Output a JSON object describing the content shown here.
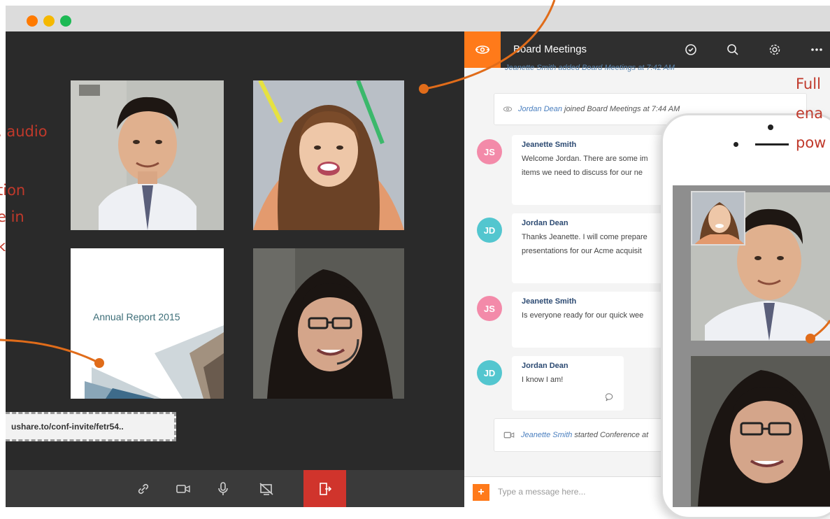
{
  "window": {
    "controls": [
      "close",
      "minimize",
      "maximize"
    ]
  },
  "annotations": {
    "left": [
      ", audio",
      "tion",
      "e in",
      "k"
    ],
    "right": [
      "Full",
      "ena",
      "pow"
    ]
  },
  "video": {
    "document_tile_title": "Annual Report 2015",
    "invite_link": "ushare.to/conf-invite/fetr54.."
  },
  "controls": {
    "icons": [
      "link-icon",
      "camera-icon",
      "microphone-icon",
      "screen-share-icon",
      "leave-icon"
    ]
  },
  "chat": {
    "title": "Board Meetings",
    "top_cut_line": "Jeanette Smith added Board Meetings at 7:42 AM",
    "join_message": {
      "user": "Jordan Dean",
      "text": "joined Board Meetings at 7:44 AM"
    },
    "messages": [
      {
        "initials": "JS",
        "name": "Jeanette Smith",
        "lines": [
          "Welcome Jordan. There are some im",
          "items we need to discuss for our ne"
        ]
      },
      {
        "initials": "JD",
        "name": "Jordan Dean",
        "lines": [
          "Thanks Jeanette. I will come prepare",
          "presentations for our Acme acquisit"
        ]
      },
      {
        "initials": "JS",
        "name": "Jeanette Smith",
        "lines": [
          "Is everyone ready for our quick wee"
        ]
      },
      {
        "initials": "JD",
        "name": "Jordan Dean",
        "lines": [
          "I know I am!"
        ]
      }
    ],
    "conference_message": {
      "user": "Jeanette Smith",
      "text": "started Conference at"
    },
    "input_placeholder": "Type a message here...",
    "add_label": "+"
  },
  "colors": {
    "accent": "#ff7a1a",
    "leave": "#d0342c",
    "annotation": "#c0392b",
    "avatar_js": "#f38aa9",
    "avatar_jd": "#53c6cf"
  }
}
